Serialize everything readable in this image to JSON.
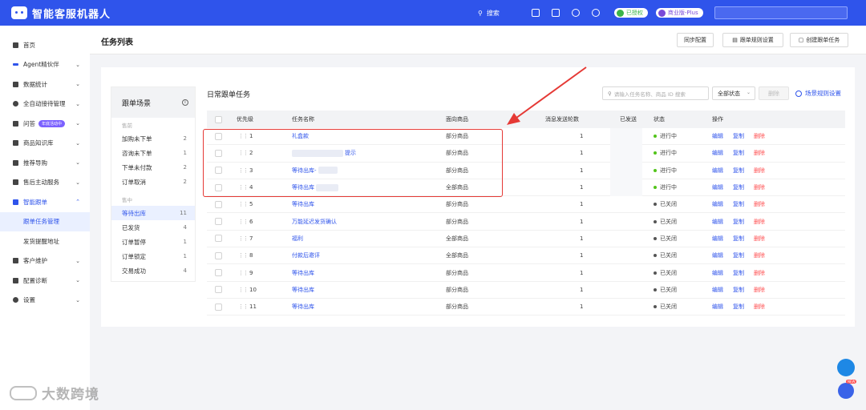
{
  "app": {
    "title": "智能客服机器人"
  },
  "topbar": {
    "search_label": "搜索",
    "auth_badge": "已授权",
    "plan_badge": "商业版-Plus"
  },
  "sidebar": {
    "items": [
      {
        "label": "首页"
      },
      {
        "label": "Agent精伙伴"
      },
      {
        "label": "数据统计"
      },
      {
        "label": "全自动接待管理"
      },
      {
        "label": "问答",
        "tag": "年底活动中"
      },
      {
        "label": "商品知识库"
      },
      {
        "label": "推荐导购"
      },
      {
        "label": "售后主动服务"
      },
      {
        "label": "智能跟单"
      },
      {
        "label": "跟单任务管理"
      },
      {
        "label": "发货提醒地址"
      },
      {
        "label": "客户维护"
      },
      {
        "label": "配置诊断"
      },
      {
        "label": "设置"
      }
    ]
  },
  "header": {
    "title": "任务列表",
    "btn_sync": "同步配置",
    "btn_rules": "跟单规则设置",
    "btn_create": "创建跟单任务"
  },
  "scene": {
    "title": "跟单场景",
    "group_pre": "售前",
    "group_mid": "售中",
    "pre_items": [
      {
        "label": "加购未下单",
        "count": "2"
      },
      {
        "label": "咨询未下单",
        "count": "1"
      },
      {
        "label": "下单未付款",
        "count": "2"
      },
      {
        "label": "订单取消",
        "count": "2"
      }
    ],
    "mid_items": [
      {
        "label": "等待出库",
        "count": "11"
      },
      {
        "label": "已发货",
        "count": "4"
      },
      {
        "label": "订单暂停",
        "count": "1"
      },
      {
        "label": "订单锁定",
        "count": "1"
      },
      {
        "label": "交易成功",
        "count": "4"
      }
    ]
  },
  "tasks": {
    "title": "日常跟单任务",
    "search_placeholder": "请输入任务名称、商品 ID 搜索",
    "status_select": "全部状态",
    "delete_btn": "删除",
    "scene_setting": "场景规则设置",
    "columns": {
      "priority": "优先级",
      "name": "任务名称",
      "goods": "面向商品",
      "rounds": "消息发送轮数",
      "sent": "已发送",
      "status": "状态",
      "ops": "操作"
    },
    "op_edit": "编辑",
    "op_copy": "复制",
    "op_delete": "删除",
    "rows": [
      {
        "priority": "1",
        "name": "礼盒款",
        "goods": "部分商品",
        "rounds": "1",
        "status": "进行中"
      },
      {
        "priority": "2",
        "name": "提示",
        "goods": "部分商品",
        "rounds": "1",
        "status": "进行中"
      },
      {
        "priority": "3",
        "name": "等待出库-",
        "goods": "部分商品",
        "rounds": "1",
        "status": "进行中"
      },
      {
        "priority": "4",
        "name": "等待出库",
        "goods": "全部商品",
        "rounds": "1",
        "status": "进行中"
      },
      {
        "priority": "5",
        "name": "等待出库",
        "goods": "部分商品",
        "rounds": "1",
        "status": "已关闭"
      },
      {
        "priority": "6",
        "name": "万能延迟发货确认",
        "goods": "部分商品",
        "rounds": "1",
        "status": "已关闭"
      },
      {
        "priority": "7",
        "name": "福利",
        "goods": "全部商品",
        "rounds": "1",
        "status": "已关闭"
      },
      {
        "priority": "8",
        "name": "付款后邀评",
        "goods": "全部商品",
        "rounds": "1",
        "status": "已关闭"
      },
      {
        "priority": "9",
        "name": "等待出库",
        "goods": "部分商品",
        "rounds": "1",
        "status": "已关闭"
      },
      {
        "priority": "10",
        "name": "等待出库",
        "goods": "部分商品",
        "rounds": "1",
        "status": "已关闭"
      },
      {
        "priority": "11",
        "name": "等待出库",
        "goods": "部分商品",
        "rounds": "1",
        "status": "已关闭"
      }
    ]
  },
  "colors": {
    "primary": "#2f54eb",
    "active_status": "#52c41a",
    "closed_status": "#555555",
    "danger": "#ff4d4f",
    "annotation": "#e53935"
  },
  "watermark": "大数跨境"
}
